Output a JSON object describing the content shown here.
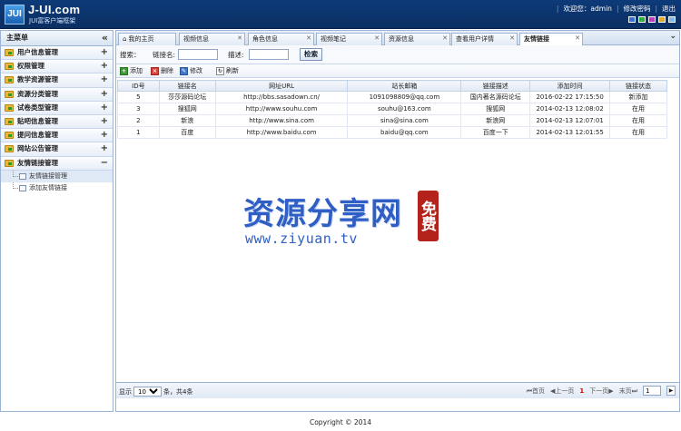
{
  "header": {
    "logo_letter": "JUI",
    "title": "J-UI.com",
    "subtitle": "JUI富客户端框架",
    "welcome": "欢迎您：admin",
    "change_password": "修改密码",
    "logout": "退出",
    "theme_colors": [
      "#3b6fd1",
      "#2fae3b",
      "#c03bc0",
      "#e0a92a",
      "#7fb7e8"
    ]
  },
  "sidebar": {
    "title": "主菜单",
    "collapse_icon": "«",
    "groups": [
      {
        "label": "用户信息管理",
        "toggle": "+"
      },
      {
        "label": "权限管理",
        "toggle": "+"
      },
      {
        "label": "教学资源管理",
        "toggle": "+"
      },
      {
        "label": "资源分类管理",
        "toggle": "+"
      },
      {
        "label": "试卷类型管理",
        "toggle": "+"
      },
      {
        "label": "贴吧信息管理",
        "toggle": "+"
      },
      {
        "label": "提问信息管理",
        "toggle": "+"
      },
      {
        "label": "网站公告管理",
        "toggle": "+"
      },
      {
        "label": "友情链接管理",
        "toggle": "−"
      }
    ],
    "sub_items": [
      {
        "label": "友情链接管理"
      },
      {
        "label": "添加友情链接"
      }
    ]
  },
  "tabs": [
    {
      "label": "我的主页"
    },
    {
      "label": "视频信息"
    },
    {
      "label": "角色信息"
    },
    {
      "label": "视频笔记"
    },
    {
      "label": "资源信息"
    },
    {
      "label": "查看用户详情"
    },
    {
      "label": "友情链接"
    }
  ],
  "search": {
    "label": "搜索：",
    "name_label": "链接名:",
    "name_value": "",
    "desc_label": "描述:",
    "desc_value": "",
    "button": "检索"
  },
  "toolbar": {
    "add": "添加",
    "delete": "删除",
    "edit": "修改",
    "refresh": "刷新"
  },
  "table": {
    "columns": [
      "ID号",
      "链接名",
      "网址URL",
      "站长邮箱",
      "链接描述",
      "添加时间",
      "链接状态"
    ],
    "rows": [
      [
        "5",
        "莎莎源码论坛",
        "http://bbs.sasadown.cn/",
        "1091098809@qq.com",
        "国内著名源码论坛",
        "2016-02-22 17:15:50",
        "新添加"
      ],
      [
        "3",
        "搜狐网",
        "http://www.souhu.com",
        "souhu@163.com",
        "搜狐网",
        "2014-02-13 12:08:02",
        "在用"
      ],
      [
        "2",
        "新浪",
        "http://www.sina.com",
        "sina@sina.com",
        "新浪网",
        "2014-02-13 12:07:01",
        "在用"
      ],
      [
        "1",
        "百度",
        "http://www.baidu.com",
        "baidu@qq.com",
        "百度一下",
        "2014-02-13 12:01:55",
        "在用"
      ]
    ]
  },
  "watermark": {
    "text": "资源分享网",
    "badge": "免费",
    "url": "www.ziyuan.tv"
  },
  "pager": {
    "show_label": "显示",
    "page_size": "10",
    "total_text": "条，共4条",
    "first": "首页",
    "prev": "上一页",
    "current": "1",
    "next": "下一页",
    "last": "末页",
    "goto_value": "1"
  },
  "footer": {
    "copyright": "Copyright © 2014"
  }
}
